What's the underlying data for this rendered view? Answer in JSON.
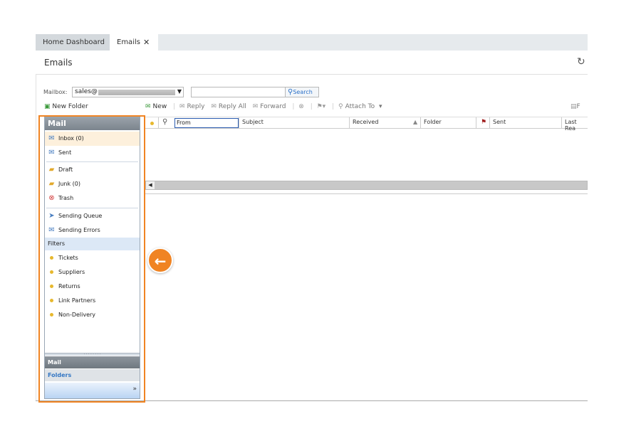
{
  "tabs": [
    {
      "label": "Home Dashboard"
    },
    {
      "label": "Emails",
      "close": "✕"
    }
  ],
  "page": {
    "title": "Emails",
    "refresh_icon": "refresh-icon"
  },
  "mailbox": {
    "label": "Mailbox:",
    "value": "sales@"
  },
  "search": {
    "value": "",
    "button": "Search"
  },
  "new_folder": "New Folder",
  "toolbar": {
    "new": "New",
    "reply": "Reply",
    "reply_all": "Reply All",
    "forward": "Forward",
    "attach_to": "Attach To",
    "right_item": "F"
  },
  "grid": {
    "columns": [
      "From",
      "Subject",
      "Received",
      "Folder",
      "Sent",
      "Last Rea"
    ]
  },
  "sidebar": {
    "header": "Mail",
    "items": [
      {
        "label": "Inbox (0)",
        "icon": "inbox-icon"
      },
      {
        "label": "Sent",
        "icon": "sent-icon"
      },
      {
        "label": "Draft",
        "icon": "folder-icon"
      },
      {
        "label": "Junk (0)",
        "icon": "folder-icon"
      },
      {
        "label": "Trash",
        "icon": "trash-icon"
      },
      {
        "label": "Sending Queue",
        "icon": "paper-plane-icon"
      },
      {
        "label": "Sending Errors",
        "icon": "error-mail-icon"
      }
    ],
    "filters_label": "Filters",
    "filters": [
      {
        "label": "Tickets"
      },
      {
        "label": "Suppliers"
      },
      {
        "label": "Returns"
      },
      {
        "label": "Link Partners"
      },
      {
        "label": "Non-Delivery"
      }
    ],
    "mail_tab": "Mail",
    "folders_tab": "Folders",
    "more": "»"
  },
  "colors": {
    "accent": "#f08423",
    "link": "#2b71c8"
  }
}
